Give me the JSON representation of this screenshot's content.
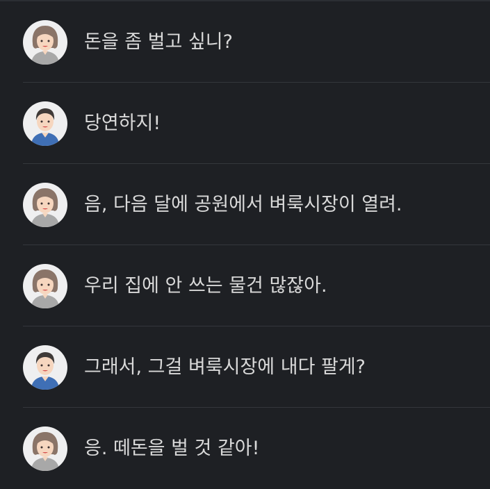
{
  "conversation": {
    "messages": [
      {
        "speaker": "woman",
        "avatar": "woman-avatar-icon",
        "text": "돈을 좀 벌고 싶니?"
      },
      {
        "speaker": "man",
        "avatar": "man-avatar-icon",
        "text": "당연하지!"
      },
      {
        "speaker": "woman",
        "avatar": "woman-avatar-icon",
        "text": "음, 다음 달에 공원에서 벼룩시장이 열려."
      },
      {
        "speaker": "woman",
        "avatar": "woman-avatar-icon",
        "text": "우리 집에 안 쓰는 물건 많잖아."
      },
      {
        "speaker": "man",
        "avatar": "man-avatar-icon",
        "text": "그래서, 그걸 벼룩시장에 내다 팔게?"
      },
      {
        "speaker": "woman",
        "avatar": "woman-avatar-icon",
        "text": "응. 떼돈을 벌 것 같아!"
      }
    ]
  },
  "colors": {
    "background": "#1e2024",
    "divider": "#34373c",
    "text": "#d9d9d9",
    "avatar_bg": "#efeff0",
    "woman_hair": "#8a7468",
    "woman_shirt": "#a8a8a8",
    "man_hair": "#3f3a38",
    "man_shirt": "#3f6fb5",
    "skin": "#f6d6bf"
  }
}
